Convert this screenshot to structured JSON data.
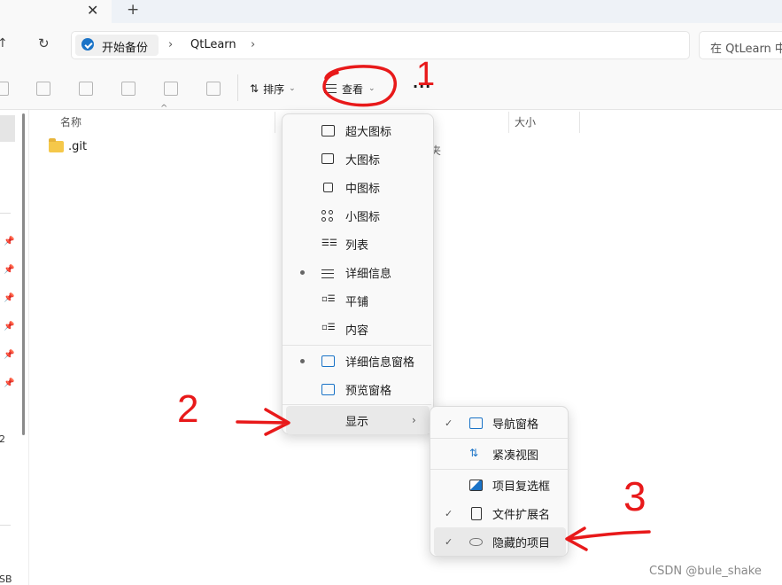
{
  "tabs": {
    "close": "✕",
    "new": "+"
  },
  "address": {
    "crumbs": [
      "开始备份",
      "QtLearn"
    ],
    "separator": "›",
    "search_placeholder": "在 QtLearn 中"
  },
  "toolbar": {
    "sort_label": "排序",
    "view_label": "查看",
    "more": "..."
  },
  "sidebar": {
    "fragments": [
      "2",
      "SB"
    ]
  },
  "columns": {
    "name": "名称",
    "size": "大小"
  },
  "files": [
    {
      "name": ".git",
      "type_fragment": "夹"
    }
  ],
  "view_menu": {
    "items": [
      {
        "label": "超大图标",
        "icon": "extra-large-icons-icon",
        "selected": false
      },
      {
        "label": "大图标",
        "icon": "large-icons-icon",
        "selected": false
      },
      {
        "label": "中图标",
        "icon": "medium-icons-icon",
        "selected": false
      },
      {
        "label": "小图标",
        "icon": "small-icons-icon",
        "selected": false
      },
      {
        "label": "列表",
        "icon": "list-icon",
        "selected": false
      },
      {
        "label": "详细信息",
        "icon": "details-icon",
        "selected": true
      },
      {
        "label": "平铺",
        "icon": "tiles-icon",
        "selected": false
      },
      {
        "label": "内容",
        "icon": "content-icon",
        "selected": false
      },
      {
        "label": "详细信息窗格",
        "icon": "details-pane-icon",
        "selected": true
      },
      {
        "label": "预览窗格",
        "icon": "preview-pane-icon",
        "selected": false
      }
    ],
    "show_label": "显示"
  },
  "show_submenu": {
    "items": [
      {
        "label": "导航窗格",
        "icon": "navigation-pane-icon",
        "checked": true
      },
      {
        "label": "紧凑视图",
        "icon": "compact-view-icon",
        "checked": false
      },
      {
        "label": "项目复选框",
        "icon": "item-checkbox-icon",
        "checked": false
      },
      {
        "label": "文件扩展名",
        "icon": "file-extension-icon",
        "checked": true
      },
      {
        "label": "隐藏的项目",
        "icon": "hidden-items-icon",
        "checked": true
      }
    ]
  },
  "annotations": {
    "one": "1",
    "two": "2",
    "three": "3"
  },
  "watermark": "CSDN @bule_shake",
  "colors": {
    "annotation_red": "#e8191a",
    "accent": "#1a73c7"
  }
}
